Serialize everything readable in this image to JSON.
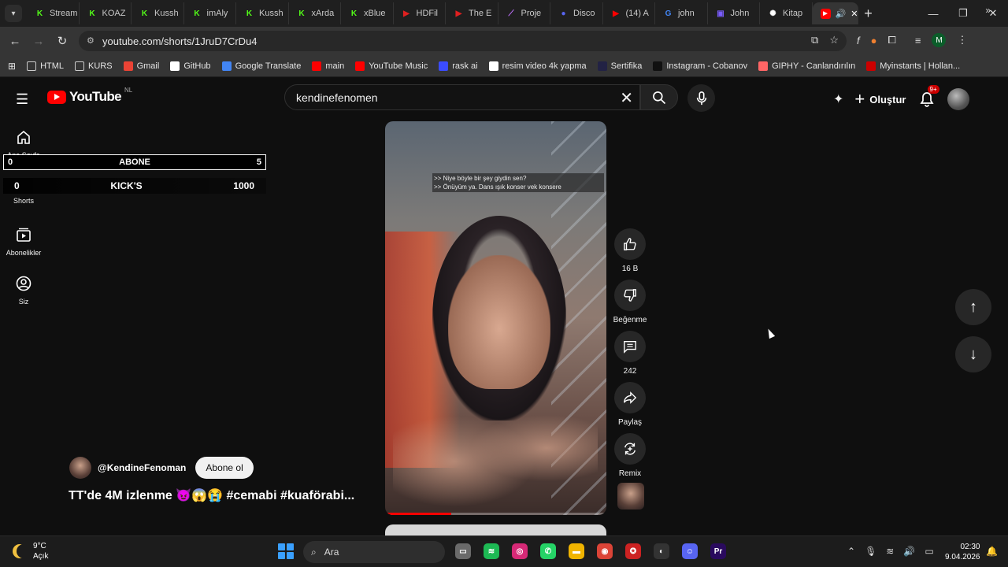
{
  "browser": {
    "tabs": [
      {
        "label": "Stream",
        "color": "#53fc18",
        "glyph": "K"
      },
      {
        "label": "KOAZ",
        "color": "#53fc18",
        "glyph": "K"
      },
      {
        "label": "Kussh",
        "color": "#53fc18",
        "glyph": "K"
      },
      {
        "label": "imAly",
        "color": "#53fc18",
        "glyph": "K"
      },
      {
        "label": "Kussh",
        "color": "#53fc18",
        "glyph": "K"
      },
      {
        "label": "xArda",
        "color": "#53fc18",
        "glyph": "K"
      },
      {
        "label": "xBlue",
        "color": "#53fc18",
        "glyph": "K"
      },
      {
        "label": "HDFil",
        "color": "#e02020",
        "glyph": "▶"
      },
      {
        "label": "The E",
        "color": "#e02020",
        "glyph": "▶"
      },
      {
        "label": "Proje",
        "color": "#c070ff",
        "glyph": "⟋"
      },
      {
        "label": "Disco",
        "color": "#5865f2",
        "glyph": "●"
      },
      {
        "label": "(14) A",
        "color": "#ff0000",
        "glyph": "▶"
      },
      {
        "label": "john",
        "color": "#4285f4",
        "glyph": "G"
      },
      {
        "label": "John",
        "color": "#7a5cff",
        "glyph": "▣"
      },
      {
        "label": "Kitap",
        "color": "#ffffff",
        "glyph": "✺"
      }
    ],
    "active_tab_icon": "youtube-red-icon",
    "url": "youtube.com/shorts/1JruD7CrDu4",
    "profile_initial": "M",
    "bookmarks": [
      {
        "label": "HTML",
        "icon": "folder-icon",
        "color": "#cccccc"
      },
      {
        "label": "KURS",
        "icon": "folder-icon",
        "color": "#cccccc"
      },
      {
        "label": "Gmail",
        "icon": "gmail-icon",
        "color": "#ea4335"
      },
      {
        "label": "GitHub",
        "icon": "github-icon",
        "color": "#ffffff"
      },
      {
        "label": "Google Translate",
        "icon": "translate-icon",
        "color": "#4285f4"
      },
      {
        "label": "main",
        "icon": "youtube-icon",
        "color": "#ff0000"
      },
      {
        "label": "YouTube Music",
        "icon": "yt-music-icon",
        "color": "#ff0000"
      },
      {
        "label": "rask ai",
        "icon": "rask-icon",
        "color": "#3b4cff"
      },
      {
        "label": "resim video 4k yapma",
        "icon": "app-icon",
        "color": "#ffffff"
      },
      {
        "label": "Sertifika",
        "icon": "globe-icon",
        "color": "#222244"
      },
      {
        "label": "Instagram - Cobanov",
        "icon": "bookmark-icon",
        "color": "#111111"
      },
      {
        "label": "GIPHY - Canlandırılın",
        "icon": "giphy-icon",
        "color": "#ff6666"
      },
      {
        "label": "Myinstants | Hollan...",
        "icon": "myinstants-icon",
        "color": "#cc0000"
      }
    ]
  },
  "youtube": {
    "logo_text": "YouTube",
    "logo_region": "NL",
    "search_value": "kendinefenomen",
    "create_label": "Oluştur",
    "notification_count": "9+",
    "sidebar": [
      {
        "label": "Ana Sayfa",
        "icon": "home-icon"
      },
      {
        "label": "Shorts",
        "icon": "shorts-icon"
      },
      {
        "label": "Abonelikler",
        "icon": "subscriptions-icon"
      },
      {
        "label": "Siz",
        "icon": "account-icon"
      }
    ],
    "overlay": {
      "abone_left": "0",
      "abone_label": "ABONE",
      "abone_right": "5",
      "kick_left": "0",
      "kick_label": "KICK'S",
      "kick_right": "1000"
    },
    "short": {
      "subtitle_line1": ">> Niye böyle bir şey giydin sen?",
      "subtitle_line2": ">> Önüyüm ya. Dans ışık konser vek konsere",
      "progress_fraction": 0.3,
      "channel_name": "@KendineFenoman",
      "subscribe_label": "Abone ol",
      "title": "TT'de 4M izlenme 😈😱😭 #cemabi #kuaförabi..."
    },
    "actions": {
      "like_count": "16 B",
      "dislike_label": "Beğenme",
      "comment_count": "242",
      "share_label": "Paylaş",
      "remix_label": "Remix"
    }
  },
  "taskbar": {
    "temperature": "9°C",
    "weather_desc": "Açık",
    "search_placeholder": "Ara",
    "time": "02:30",
    "date": "9.04.2026",
    "apps": [
      {
        "name": "file-explorer-window",
        "color": "#6a6a6a",
        "glyph": "▭"
      },
      {
        "name": "spotify",
        "color": "#1db954",
        "glyph": "≋"
      },
      {
        "name": "instagram",
        "color": "#d62976",
        "glyph": "◎"
      },
      {
        "name": "whatsapp",
        "color": "#25d366",
        "glyph": "✆"
      },
      {
        "name": "folder",
        "color": "#f0b400",
        "glyph": "▬"
      },
      {
        "name": "chrome",
        "color": "#db4437",
        "glyph": "◉"
      },
      {
        "name": "game-app",
        "color": "#cc2222",
        "glyph": "✪"
      },
      {
        "name": "steam",
        "color": "#333333",
        "glyph": "◐"
      },
      {
        "name": "discord",
        "color": "#5865f2",
        "glyph": "☺"
      },
      {
        "name": "premiere",
        "color": "#2a0a5e",
        "glyph": "Pr"
      }
    ]
  }
}
